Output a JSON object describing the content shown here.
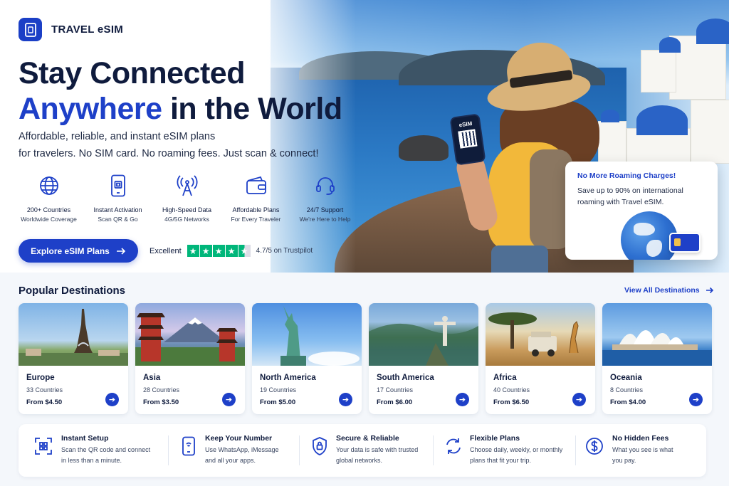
{
  "brand": {
    "name": "TRAVEL eSIM"
  },
  "hero": {
    "headline_line1": "Stay Connected",
    "headline_accent": "Anywhere",
    "headline_rest": " in the World",
    "subtitle_line1": "Affordable, reliable, and instant eSIM plans",
    "subtitle_line2": "for travelers. No SIM card. No roaming fees. Just scan & connect!",
    "phone_label": "eSIM",
    "features": [
      {
        "icon": "globe-icon",
        "title": "200+ Countries",
        "sub": "Worldwide Coverage"
      },
      {
        "icon": "qr-phone-icon",
        "title": "Instant Activation",
        "sub": "Scan QR & Go"
      },
      {
        "icon": "signal-tower-icon",
        "title": "High-Speed Data",
        "sub": "4G/5G Networks"
      },
      {
        "icon": "wallet-icon",
        "title": "Affordable Plans",
        "sub": "For Every Traveler"
      },
      {
        "icon": "headset-icon",
        "title": "24/7 Support",
        "sub": "We're Here to Help"
      }
    ],
    "cta_label": "Explore eSIM Plans",
    "rating": {
      "label": "Excellent",
      "score_text": "4.7/5 on Trustpilot",
      "stars": 4.5
    },
    "promo": {
      "title": "No More Roaming Charges!",
      "text": "Save up to 90% on international roaming with Travel eSIM."
    }
  },
  "destinations": {
    "title": "Popular Destinations",
    "view_all": "View All Destinations",
    "items": [
      {
        "name": "Europe",
        "count": "33 Countries",
        "price": "From $4.50"
      },
      {
        "name": "Asia",
        "count": "28 Countries",
        "price": "From $3.50"
      },
      {
        "name": "North America",
        "count": "19 Countries",
        "price": "From $5.00"
      },
      {
        "name": "South America",
        "count": "17 Countries",
        "price": "From $6.00"
      },
      {
        "name": "Africa",
        "count": "40 Countries",
        "price": "From $6.50"
      },
      {
        "name": "Oceania",
        "count": "8 Countries",
        "price": "From $4.00"
      }
    ]
  },
  "benefits": [
    {
      "icon": "qr-scan-icon",
      "title": "Instant Setup",
      "line1": "Scan the QR code and connect",
      "line2": "in less than a minute."
    },
    {
      "icon": "phone-icon",
      "title": "Keep Your Number",
      "line1": "Use WhatsApp, iMessage",
      "line2": "and all your apps."
    },
    {
      "icon": "shield-lock-icon",
      "title": "Secure & Reliable",
      "line1": "Your data is safe with trusted",
      "line2": "global networks."
    },
    {
      "icon": "refresh-icon",
      "title": "Flexible Plans",
      "line1": "Choose daily, weekly, or monthly",
      "line2": "plans that fit your trip."
    },
    {
      "icon": "dollar-icon",
      "title": "No Hidden Fees",
      "line1": "What you see is what",
      "line2": "you pay."
    }
  ],
  "colors": {
    "accent": "#1e40c8",
    "text": "#0f1b3d",
    "trustpilot": "#00b67a"
  }
}
